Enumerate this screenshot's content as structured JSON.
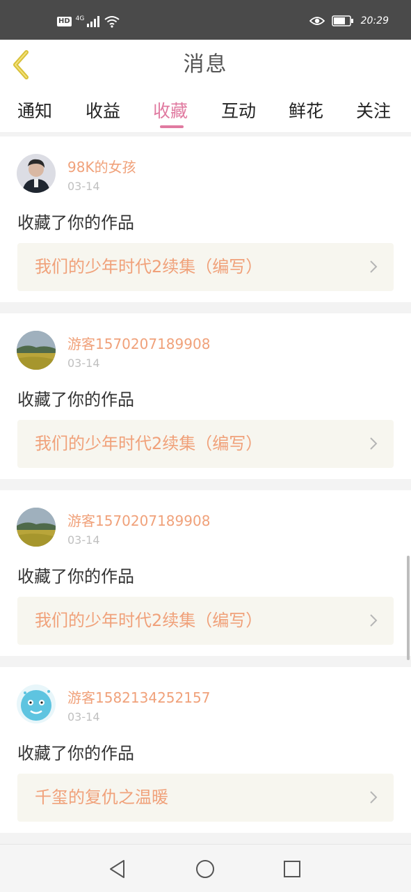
{
  "status_bar": {
    "hd": "HD",
    "network": "4G",
    "time": "20:29"
  },
  "header": {
    "title": "消息",
    "back_icon": "chevron-left-icon"
  },
  "tabs": [
    {
      "label": "通知",
      "active": false
    },
    {
      "label": "收益",
      "active": false
    },
    {
      "label": "收藏",
      "active": true
    },
    {
      "label": "互动",
      "active": false
    },
    {
      "label": "鲜花",
      "active": false
    },
    {
      "label": "关注",
      "active": false
    }
  ],
  "items": [
    {
      "username": "98K的女孩",
      "date": "03-14",
      "action": "收藏了你的作品",
      "work_title": "我们的少年时代2续集（编写）",
      "avatar": "person-avatar"
    },
    {
      "username": "游客1570207189908",
      "date": "03-14",
      "action": "收藏了你的作品",
      "work_title": "我们的少年时代2续集（编写）",
      "avatar": "landscape-avatar"
    },
    {
      "username": "游客1570207189908",
      "date": "03-14",
      "action": "收藏了你的作品",
      "work_title": "我们的少年时代2续集（编写）",
      "avatar": "landscape-avatar"
    },
    {
      "username": "游客1582134252157",
      "date": "03-14",
      "action": "收藏了你的作品",
      "work_title": "千玺的复仇之温暖",
      "avatar": "cartoon-avatar"
    }
  ],
  "colors": {
    "accent_pink": "#e07aa0",
    "accent_orange": "#f0a17a",
    "back_icon_yellow": "#d8c13a"
  }
}
